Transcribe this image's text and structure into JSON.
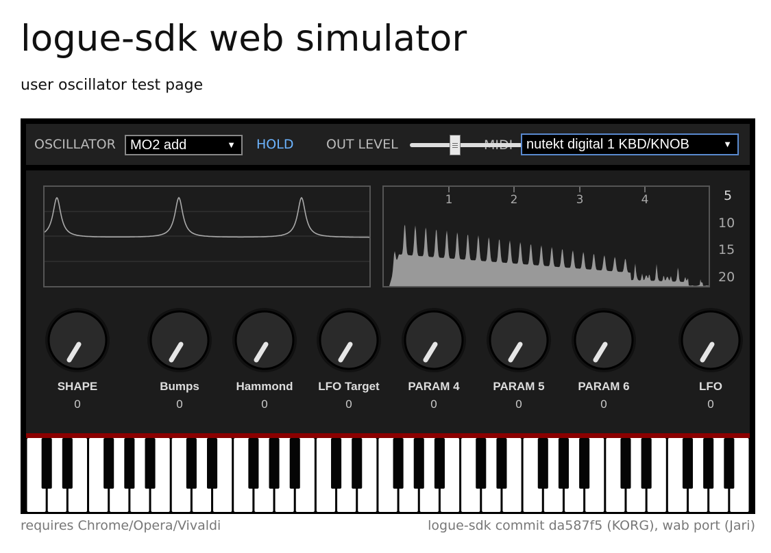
{
  "header": {
    "title": "logue-sdk web simulator",
    "subtitle": "user oscillator test page"
  },
  "topbar": {
    "oscillator_label": "OSCILLATOR",
    "oscillator_value": "MO2 add",
    "hold_label": "HOLD",
    "out_level_label": "OUT LEVEL",
    "out_level_value": 0.4,
    "midi_label": "MIDI",
    "midi_value": "nutekt digital 1 KBD/KNOB"
  },
  "spectrum": {
    "x_ticks": [
      "1",
      "2",
      "3",
      "4"
    ],
    "y_ticks": [
      "5",
      "10",
      "15",
      "20"
    ]
  },
  "knobs": [
    {
      "name": "SHAPE",
      "value": "0"
    },
    {
      "name": "Bumps",
      "value": "0"
    },
    {
      "name": "Hammond",
      "value": "0"
    },
    {
      "name": "LFO Target",
      "value": "0"
    },
    {
      "name": "PARAM 4",
      "value": "0"
    },
    {
      "name": "PARAM 5",
      "value": "0"
    },
    {
      "name": "PARAM 6",
      "value": "0"
    },
    {
      "name": "LFO",
      "value": "0"
    }
  ],
  "footer": {
    "left": "requires Chrome/Opera/Vivaldi",
    "right": "logue-sdk commit da587f5 (KORG), wab port (Jari)"
  },
  "colors": {
    "accent": "#6cb4ff",
    "keyboard_bar": "#8b0000",
    "panel": "#1c1c1c"
  }
}
